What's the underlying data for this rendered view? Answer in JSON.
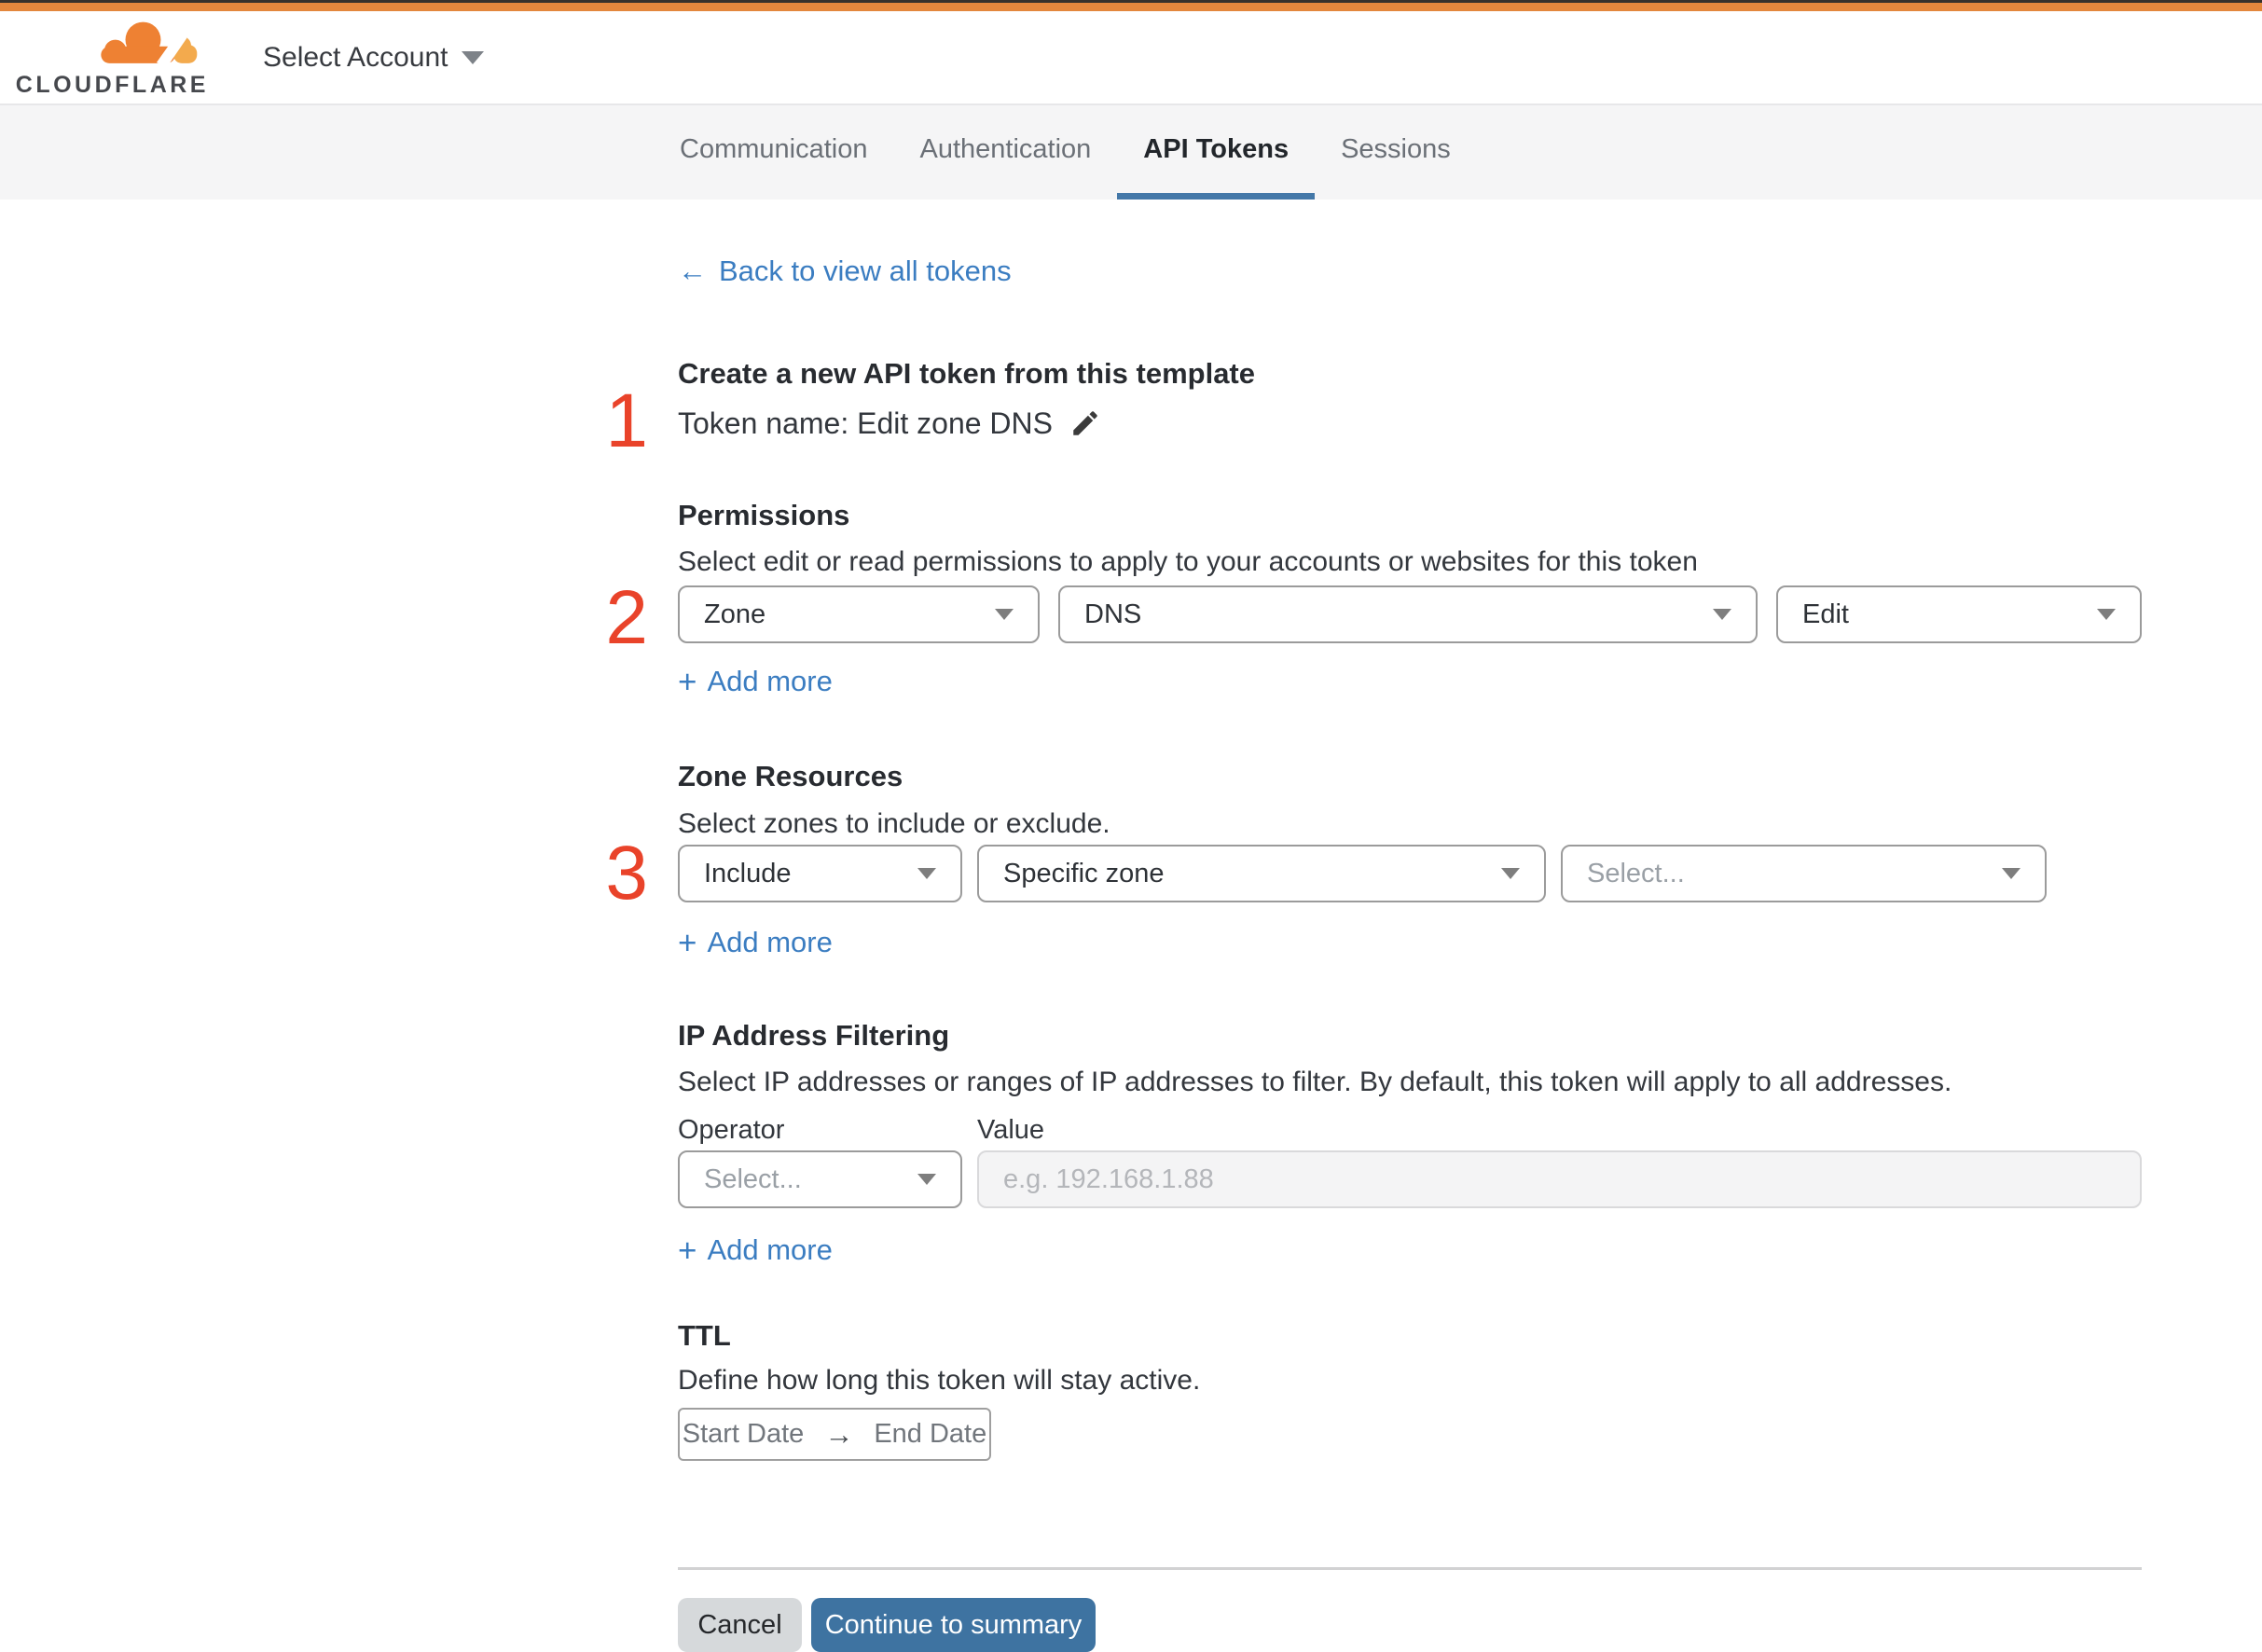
{
  "header": {
    "logo_text": "CLOUDFLARE",
    "account_selector": "Select Account"
  },
  "tabs": [
    {
      "label": "Communication",
      "active": false
    },
    {
      "label": "Authentication",
      "active": false
    },
    {
      "label": "API Tokens",
      "active": true
    },
    {
      "label": "Sessions",
      "active": false
    }
  ],
  "back_link": {
    "label": "Back to view all tokens"
  },
  "icons": {
    "back": "←",
    "plus": "+",
    "arrow_right": "→"
  },
  "token_section": {
    "step_number": "1",
    "heading": "Create a new API token from this template",
    "token_label": "Token name: Edit zone DNS"
  },
  "permissions": {
    "step_number": "2",
    "heading": "Permissions",
    "description": "Select edit or read permissions to apply to your accounts or websites for this token",
    "scope_value": "Zone",
    "permission_group_value": "DNS",
    "access_value": "Edit",
    "add_more_label": "Add more"
  },
  "zone_resources": {
    "step_number": "3",
    "heading": "Zone Resources",
    "description": "Select zones to include or exclude.",
    "operator_value": "Include",
    "type_value": "Specific zone",
    "zone_placeholder": "Select...",
    "add_more_label": "Add more"
  },
  "ip_filtering": {
    "heading": "IP Address Filtering",
    "description": "Select IP addresses or ranges of IP addresses to filter. By default, this token will apply to all addresses.",
    "operator_label": "Operator",
    "value_label": "Value",
    "operator_placeholder": "Select...",
    "value_placeholder": "e.g. 192.168.1.88",
    "add_more_label": "Add more"
  },
  "ttl": {
    "heading": "TTL",
    "description": "Define how long this token will stay active.",
    "start_label": "Start Date",
    "end_label": "End Date"
  },
  "footer": {
    "cancel_label": "Cancel",
    "continue_label": "Continue to summary"
  },
  "colors": {
    "accent_orange": "#e3873d",
    "step_number_red": "#e9432a",
    "link_blue": "#3b7dc1",
    "primary_button_blue": "#3e73a1",
    "active_tab_underline": "#4478a8",
    "cancel_button_gray": "#d6d9db"
  }
}
